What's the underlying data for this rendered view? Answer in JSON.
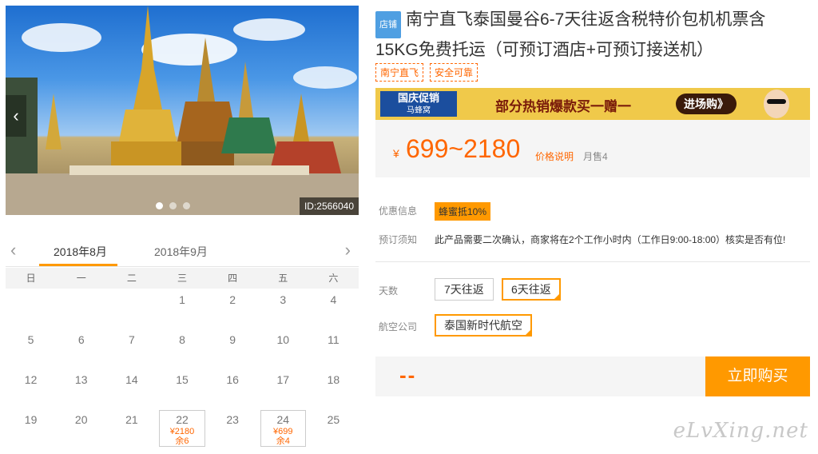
{
  "hero": {
    "prev_label": "‹",
    "next_label": "›",
    "id_tag": "ID:2566040",
    "dots": 3,
    "active_dot": 0
  },
  "calendar": {
    "prev": "‹",
    "next": "›",
    "months": [
      "2018年8月",
      "2018年9月"
    ],
    "active_month": 0,
    "weekdays": [
      "日",
      "一",
      "二",
      "三",
      "四",
      "五",
      "六"
    ],
    "rows": [
      [
        {
          "d": ""
        },
        {
          "d": ""
        },
        {
          "d": ""
        },
        {
          "d": "1"
        },
        {
          "d": "2"
        },
        {
          "d": "3"
        },
        {
          "d": "4"
        }
      ],
      [
        {
          "d": "5"
        },
        {
          "d": "6"
        },
        {
          "d": "7"
        },
        {
          "d": "8"
        },
        {
          "d": "9"
        },
        {
          "d": "10"
        },
        {
          "d": "11"
        }
      ],
      [
        {
          "d": "12"
        },
        {
          "d": "13"
        },
        {
          "d": "14"
        },
        {
          "d": "15"
        },
        {
          "d": "16"
        },
        {
          "d": "17"
        },
        {
          "d": "18"
        }
      ],
      [
        {
          "d": "19"
        },
        {
          "d": "20"
        },
        {
          "d": "21"
        },
        {
          "d": "22",
          "price": "¥2180",
          "stock": "余6"
        },
        {
          "d": "23"
        },
        {
          "d": "24",
          "price": "¥699",
          "stock": "余4"
        },
        {
          "d": "25"
        }
      ]
    ]
  },
  "product": {
    "shop_badge": "店铺",
    "title_line1": "南宁直飞泰国曼谷6-7天往返含税特价包机机票含",
    "title_line2": "15KG免费托运（可预订酒店+可预订接送机）",
    "tags": [
      "南宁直飞",
      "安全可靠"
    ]
  },
  "banner": {
    "left_title": "国庆促销",
    "left_sub": "马蜂窝",
    "middle": "部分热销爆款买一赠一",
    "button": "进场购》"
  },
  "price": {
    "yen": "¥",
    "range": "699~2180",
    "explain": "价格说明",
    "sold": "月售4"
  },
  "info": {
    "promo_label": "优惠信息",
    "promo_value": "蜂蜜抵10%",
    "notice_label": "预订须知",
    "notice_value": "此产品需要二次确认，商家将在2个工作小时内（工作日9:00-18:00）核实是否有位!"
  },
  "options": {
    "days_label": "天数",
    "days": [
      "7天往返",
      "6天往返"
    ],
    "days_selected": 1,
    "airline_label": "航空公司",
    "airlines": [
      "泰国新时代航空"
    ],
    "airline_selected": 0
  },
  "buy": {
    "qty": "--",
    "button": "立即购买"
  },
  "watermark": "eLvXing.net",
  "colors": {
    "accent": "#ff9900",
    "price": "#ff6600",
    "badge": "#4f9fe2"
  }
}
